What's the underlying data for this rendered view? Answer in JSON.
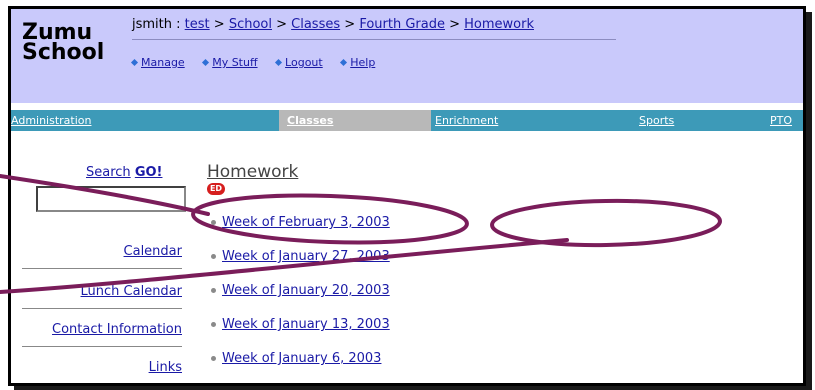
{
  "logo": {
    "line1": "Zumu",
    "line2": "School"
  },
  "breadcrumb": {
    "user": "jsmith",
    "separator": ":",
    "items": [
      "test",
      "School",
      "Classes",
      "Fourth Grade",
      "Homework"
    ]
  },
  "toplinks": [
    "Manage",
    "My Stuff",
    "Logout",
    "Help"
  ],
  "nav": {
    "items": [
      "Administration",
      "Classes",
      "Enrichment",
      "Sports",
      "PTO"
    ],
    "active": "Classes"
  },
  "sidebar": {
    "search_label": "Search",
    "search_go": "GO!",
    "search_value": "",
    "links": [
      "Calendar",
      "Lunch Calendar",
      "Contact Information",
      "Links"
    ]
  },
  "content": {
    "title": "Homework",
    "badge": "ED",
    "weeks": [
      "Week of February 3, 2003",
      "Week of January 27, 2003",
      "Week of January 20, 2003",
      "Week of January 13, 2003",
      "Week of January 6, 2003"
    ]
  },
  "colors": {
    "header_bg": "#c9c9fb",
    "nav_bg": "#3d9ab8",
    "nav_active_bg": "#b8b8b8",
    "link": "#1a1aa6",
    "annotation": "#7a1d5a",
    "badge": "#d61e1e"
  }
}
